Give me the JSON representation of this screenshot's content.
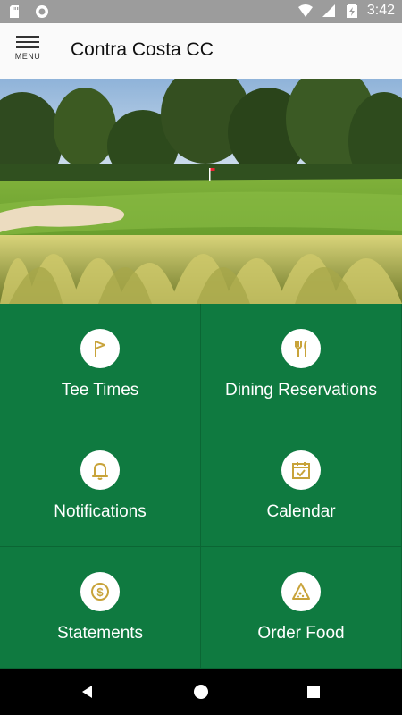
{
  "status_bar": {
    "time": "3:42"
  },
  "app_bar": {
    "menu_label": "MENU",
    "title": "Contra Costa CC"
  },
  "tiles": [
    {
      "label": "Tee Times",
      "icon": "flag-icon"
    },
    {
      "label": "Dining Reservations",
      "icon": "utensils-icon"
    },
    {
      "label": "Notifications",
      "icon": "bell-icon"
    },
    {
      "label": "Calendar",
      "icon": "calendar-icon"
    },
    {
      "label": "Statements",
      "icon": "dollar-icon"
    },
    {
      "label": "Order Food",
      "icon": "pizza-icon"
    }
  ],
  "colors": {
    "tile_green": "#0f7a40",
    "icon_gold": "#c8a33a"
  }
}
